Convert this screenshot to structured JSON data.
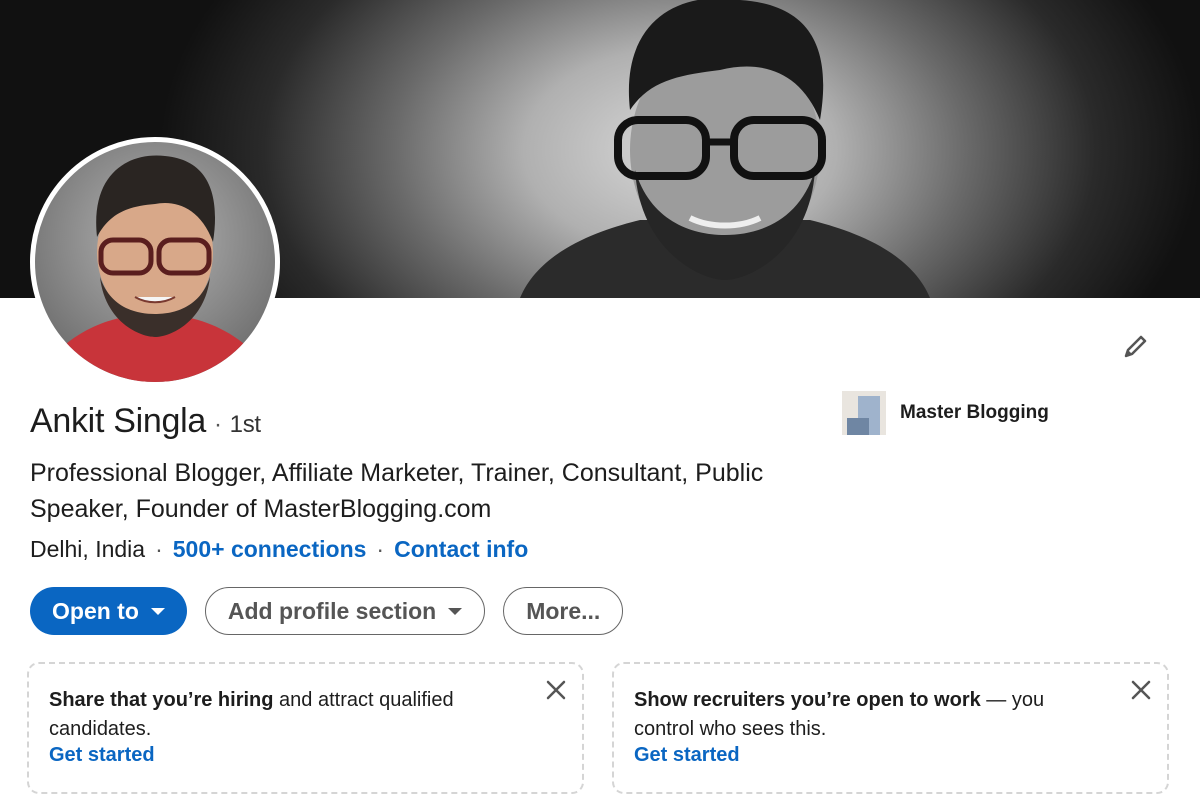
{
  "profile": {
    "name": "Ankit Singla",
    "connection_degree": "1st",
    "separator": "·",
    "headline": "Professional Blogger, Affiliate Marketer, Trainer, Consultant, Public Speaker, Founder of MasterBlogging.com",
    "location": "Delhi, India",
    "connections_label": "500+ connections",
    "contact_info_label": "Contact info"
  },
  "company": {
    "name": "Master Blogging"
  },
  "actions": {
    "open_to_label": "Open to",
    "add_section_label": "Add profile section",
    "more_label": "More..."
  },
  "cards": [
    {
      "bold": "Share that you’re hiring",
      "rest": " and attract qualified candidates.",
      "link": "Get started"
    },
    {
      "bold": "Show recruiters you’re open to work",
      "rest": " — you control who sees this.",
      "link": "Get started"
    }
  ],
  "colors": {
    "accent": "#0a66c2",
    "text": "#1d1d1d"
  }
}
